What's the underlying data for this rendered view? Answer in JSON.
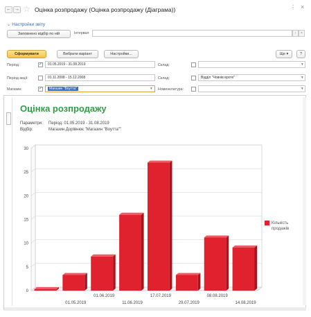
{
  "window": {
    "title": "Оцінка розпродажу (Оцінка розпродажу (Діаграма))"
  },
  "settings_link": "Настройки звіту",
  "variant_row": {
    "button": "Заповнено відбір по ній",
    "label": "Інтервал",
    "value": ""
  },
  "toolbar": {
    "form_button": "Сформувати",
    "choose_variant_button": "Вибрати варіант",
    "settings_button": "Настройки...",
    "more_button": "Ще ▾",
    "help_button": "?"
  },
  "filters": {
    "period_label": "Період:",
    "period_value": "01.05.2019 - 31.08.2019",
    "period_checked": true,
    "stock_period_label": "Період акції:",
    "stock_period_value": "01.11.2008 - 15.12.2008",
    "stock_period_checked": false,
    "store_label": "Магазин:",
    "store_value": "Магазин \"Воутта\"",
    "store_checked": true,
    "warehouse_label": "Склад:",
    "warehouse_value": "",
    "warehouse_checked": false,
    "storage_label": "Склад:",
    "storage_value": "Відділ \"Човнів вроте\"",
    "storage_checked": false,
    "nomenclature_label": "Номенклатура:",
    "nomenclature_value": "",
    "nomenclature_checked": false
  },
  "report": {
    "title": "Оцінка розпродажу",
    "params_label": "Параметри:",
    "params_value": "Період: 01.05.2019 - 31.08.2019",
    "filter_label": "Відбір:",
    "filter_value": "Магазин Дорівнює \"Магазин \"Воутта\"\""
  },
  "chart_data": {
    "type": "bar",
    "categories": [
      "",
      "01.05.2019",
      "01.06.2019",
      "11.06.2019",
      "17.07.2019",
      "29.07.2019",
      "08.08.2019",
      "14.08.2019"
    ],
    "x_tick_rows": [
      [
        "01.06.2019",
        "17.07.2019",
        "08.08.2019"
      ],
      [
        "01.05.2019",
        "11.06.2019",
        "29.07.2019",
        "14.08.2019"
      ]
    ],
    "series": [
      {
        "name": "Кількість продажів",
        "values": [
          0.3,
          3.3,
          7.2,
          16,
          27,
          3.3,
          11.2,
          9.1
        ],
        "color": "#e0222e"
      }
    ],
    "y_ticks": [
      0,
      5,
      10,
      15,
      20,
      25,
      30
    ],
    "ylim": [
      0,
      30
    ],
    "legend_position": "right"
  }
}
